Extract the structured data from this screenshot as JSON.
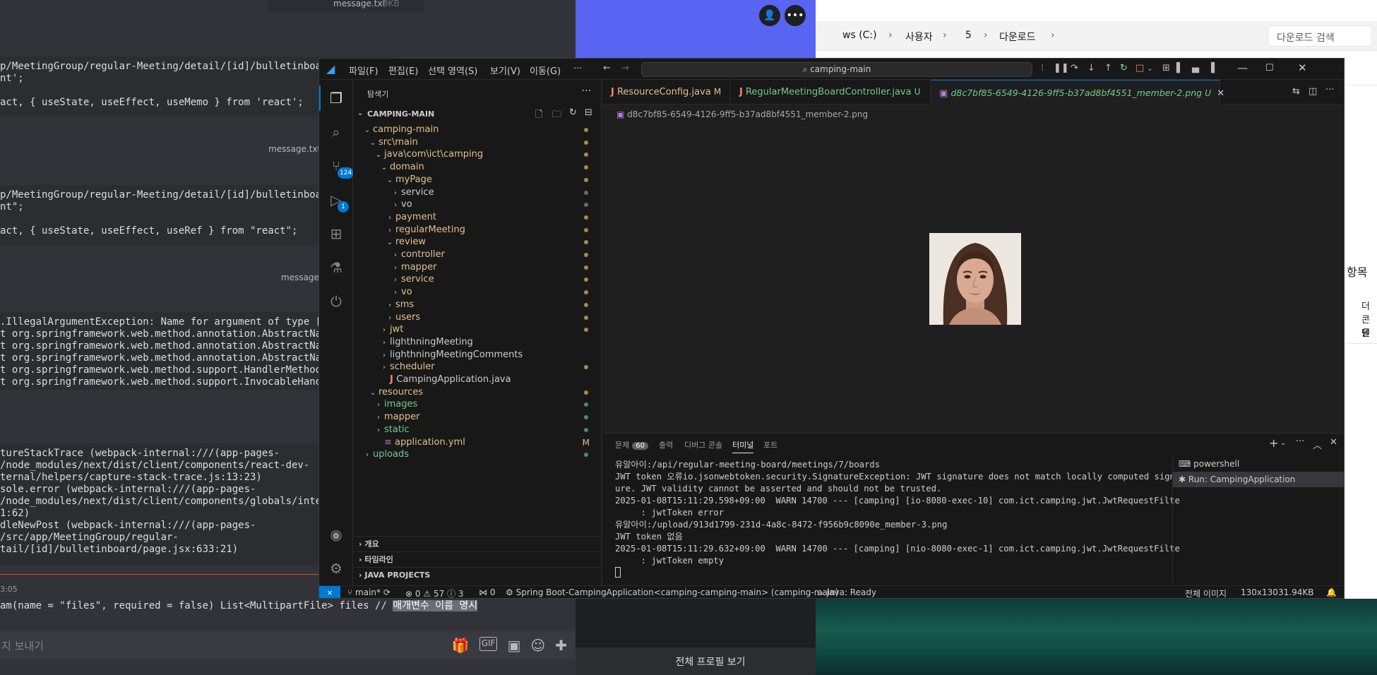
{
  "discord": {
    "top_file": "message.txt",
    "top_file_size": "9KB",
    "block1": [
      "p/MeetingGroup/regular-Meeting/detail/[id]/bulletinboa",
      "nt';",
      "",
      "act, { useState, useEffect, useMemo } from 'react';"
    ],
    "file2": "message.txt",
    "block2": [
      "p/MeetingGroup/regular-Meeting/detail/[id]/bulletinboa",
      "nt\";",
      "",
      "act, { useState, useEffect, useRef } from \"react\";"
    ],
    "file3": "message.",
    "block3": [
      ".IllegalArgumentException: Name for argument of type [",
      "t org.springframework.web.method.annotation.AbstractNa",
      "t org.springframework.web.method.annotation.AbstractNa",
      "t org.springframework.web.method.annotation.AbstractNa",
      "t org.springframework.web.method.support.HandlerMethod",
      "t org.springframework.web.method.support.InvocableHand"
    ],
    "block4": [
      "tureStackTrace (webpack-internal:///(app-pages-",
      "/node_modules/next/dist/client/components/react-dev-",
      "ternal/helpers/capture-stack-trace.js:13:23)",
      "sole.error (webpack-internal:///(app-pages-",
      "/node_modules/next/dist/client/components/globals/inte",
      "1:62)",
      "dleNewPost (webpack-internal:///(app-pages-",
      "/src/app/MeetingGroup/regular-",
      "tail/[id]/bulletinboard/page.jsx:633:21)"
    ],
    "timestamp": "3:05",
    "selected_line_prefix": "am(name = \"files\", required = false) List<MultipartFile> files // ",
    "selected_line_highlight": "매개변수 이름 명시",
    "input_placeholder": "지 보내기"
  },
  "profile": {
    "full_profile_button": "전체 프로필 보기"
  },
  "explorer": {
    "breadcrumbs": [
      "ws (C:)",
      "사용자",
      "5",
      "다운로드"
    ],
    "search_placeholder": "다운로드 검색",
    "peek_heading": "항목",
    "peek_text": [
      "더 ",
      "콘텐",
      "을 "
    ]
  },
  "vscode": {
    "menu": [
      "파일(F)",
      "편집(E)",
      "선택 영역(S)",
      "보기(V)",
      "이동(G)",
      "···"
    ],
    "command_center": "camping-main",
    "activity": {
      "source_control_badge": "124",
      "run_badge": "1"
    },
    "sidebar": {
      "title": "탐색기",
      "root": "CAMPING-MAIN",
      "tree": [
        {
          "label": "camping-main",
          "chev": "⌄",
          "color": "#e2c08d",
          "dot": "#a58a4f"
        },
        {
          "label": "src\\main",
          "chev": "⌄",
          "color": "#e2c08d",
          "dot": "#a58a4f"
        },
        {
          "label": "java\\com\\ict\\camping",
          "chev": "⌄",
          "color": "#e2c08d",
          "dot": "#a58a4f"
        },
        {
          "label": "domain",
          "chev": "⌄",
          "color": "#e2c08d",
          "dot": "#a58a4f"
        },
        {
          "label": "myPage",
          "chev": "⌄",
          "color": "#e2c08d",
          "dot": "#a58a4f"
        },
        {
          "label": "service",
          "chev": "›",
          "color": "#cccccc",
          "dot": "#6a6a6a"
        },
        {
          "label": "vo",
          "chev": "›",
          "color": "#cccccc",
          "dot": "#6a6a6a"
        },
        {
          "label": "payment",
          "chev": "›",
          "color": "#e2c08d",
          "dot": "#a58a4f"
        },
        {
          "label": "regularMeeting",
          "chev": "›",
          "color": "#e2c08d",
          "dot": "#a58a4f"
        },
        {
          "label": "review",
          "chev": "⌄",
          "color": "#e2c08d",
          "dot": "#a58a4f"
        },
        {
          "label": "controller",
          "chev": "›",
          "color": "#e2c08d",
          "dot": "#a58a4f"
        },
        {
          "label": "mapper",
          "chev": "›",
          "color": "#e2c08d",
          "dot": "#a58a4f"
        },
        {
          "label": "service",
          "chev": "›",
          "color": "#e2c08d",
          "dot": "#a58a4f"
        },
        {
          "label": "vo",
          "chev": "›",
          "color": "#e2c08d",
          "dot": "#a58a4f"
        },
        {
          "label": "sms",
          "chev": "›",
          "color": "#e2c08d",
          "dot": "#a58a4f"
        },
        {
          "label": "users",
          "chev": "›",
          "color": "#e2c08d",
          "dot": "#a58a4f"
        },
        {
          "label": "jwt",
          "chev": "›",
          "color": "#e2c08d",
          "dot": "#a58a4f"
        },
        {
          "label": "lighthningMeeting",
          "chev": "›",
          "color": "#cccccc",
          "dot": ""
        },
        {
          "label": "lighthningMeetingComments",
          "chev": "›",
          "color": "#cccccc",
          "dot": ""
        },
        {
          "label": "scheduler",
          "chev": "›",
          "color": "#e2c08d",
          "dot": "#a58a4f"
        },
        {
          "label": "CampingApplication.java",
          "chev": "",
          "color": "#cccccc",
          "dot": "",
          "java": true
        },
        {
          "label": "resources",
          "chev": "⌄",
          "color": "#e2c08d",
          "dot": "#a58a4f"
        },
        {
          "label": "images",
          "chev": "›",
          "color": "#73c991",
          "dot": "#4b8a61"
        },
        {
          "label": "mapper",
          "chev": "›",
          "color": "#e2c08d",
          "dot": "#4b8a61"
        },
        {
          "label": "static",
          "chev": "›",
          "color": "#73c991",
          "dot": "#4b8a61"
        },
        {
          "label": "application.yml",
          "chev": "",
          "color": "#e2c08d",
          "dot": "",
          "mark": "M"
        },
        {
          "label": "uploads",
          "chev": "›",
          "color": "#73c991",
          "dot": "#4b8a61"
        }
      ],
      "sections": [
        "개요",
        "타임라인",
        "JAVA PROJECTS"
      ]
    },
    "tabs": [
      {
        "label": "ResourceConfig.java",
        "mark": "M",
        "color": "#e2c08d"
      },
      {
        "label": "RegularMeetingBoardController.java",
        "mark": "U",
        "color": "#73c991"
      },
      {
        "label": "d8c7bf85-6549-4126-9ff5-b37ad8bf4551_member-2.png",
        "mark": "U",
        "color": "#73c991"
      }
    ],
    "image_breadcrumb": "d8c7bf85-6549-4126-9ff5-b37ad8bf4551_member-2.png",
    "panel": {
      "tabs": [
        "문제",
        "출력",
        "디버그 콘솔",
        "터미널",
        "포트"
      ],
      "problems_count": "60",
      "terminal_lines": [
        "유알아이:/api/regular-meeting-board/meetings/7/boards",
        "JWT token 오류io.jsonwebtoken.security.SignatureException: JWT signature does not match locally computed signat",
        "ure. JWT validity cannot be asserted and should not be trusted.",
        "2025-01-08T15:11:29.598+09:00  WARN 14700 --- [camping] [io-8080-exec-10] com.ict.camping.jwt.JwtRequestFilter",
        "     : jwtToken error",
        "유알아이:/upload/913d1799-231d-4a8c-8472-f956b9c8090e_member-3.png",
        "JWT token 없음",
        "2025-01-08T15:11:29.632+09:00  WARN 14700 --- [camping] [nio-8080-exec-1] com.ict.camping.jwt.JwtRequestFilter",
        "     : jwtToken empty"
      ],
      "terminals": [
        "powershell",
        "Run: CampingApplication"
      ]
    },
    "status": {
      "branch": "main*",
      "errors": "0",
      "warnings": "57",
      "info": "3",
      "ports": "0",
      "spring": "Spring Boot-CampingApplication<camping-camping-main> (camping-main)",
      "java": "Java: Ready",
      "image_mode": "전체 이미지",
      "dimensions": "130x130",
      "filesize": "31.94KB"
    }
  }
}
